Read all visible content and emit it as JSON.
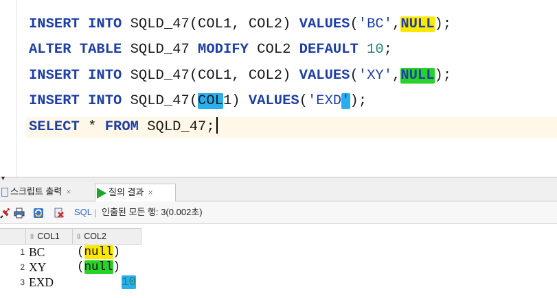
{
  "editor": {
    "lines": [
      {
        "kw1": "INSERT INTO",
        "t1": " SQLD_47(COL1, COL2) ",
        "kw2": "VALUES",
        "t2": "(",
        "str": "'BC'",
        "t3": ",",
        "hl": "NULL",
        "t4": ");"
      },
      {
        "kw1": "ALTER TABLE",
        "t1": " SQLD_47 ",
        "kw2": "MODIFY",
        "t2": " COL2 ",
        "kw3": "DEFAULT",
        "t3": " ",
        "num": "10",
        "t4": ";"
      },
      {
        "kw1": "INSERT INTO",
        "t1": " SQLD_47(COL1, COL2) ",
        "kw2": "VALUES",
        "t2": "(",
        "str": "'XY'",
        "t3": ",",
        "hl": "NULL",
        "t4": ");"
      },
      {
        "kw1": "INSERT INTO",
        "t1": " SQLD_47(",
        "hl": "COL",
        "t2": "1) ",
        "kw2": "VALUES",
        "t3": "(",
        "str": "'EXD",
        "hl2": "'",
        "t4": ");"
      },
      {
        "kw1": "SELECT",
        "t1": " * ",
        "kw2": "FROM",
        "t2": " SQLD_47;"
      }
    ]
  },
  "tabs": [
    {
      "label": "스크립트 출력",
      "close": "×",
      "icon": "document-icon"
    },
    {
      "label": "질의 결과",
      "close": "×",
      "icon": "play-icon",
      "active": true
    }
  ],
  "toolbar": {
    "icons": [
      "pin-icon",
      "print-icon",
      "refresh-icon",
      "clear-icon"
    ],
    "sql_label": "SQL",
    "separator": "|",
    "status": "인출된 모든 행: 3(0.002초)"
  },
  "grid": {
    "columns": [
      "COL1",
      "COL2"
    ],
    "rows": [
      {
        "n": "1",
        "col1": "BC",
        "col2": "(null)"
      },
      {
        "n": "2",
        "col1": "XY",
        "col2": "(null)"
      },
      {
        "n": "3",
        "col1": "EXD",
        "col2": "10"
      }
    ]
  },
  "colors": {
    "keyword": "#1d3ea8",
    "number": "#21877a",
    "highlight_yellow": "#ffe800",
    "highlight_green": "#29d22a",
    "highlight_blue": "#29aeee",
    "current_line": "#fff8e8"
  }
}
